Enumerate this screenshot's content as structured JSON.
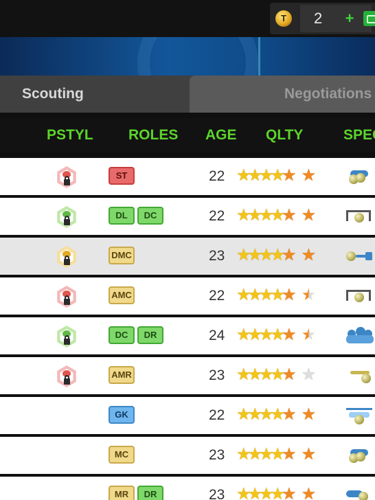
{
  "topbar": {
    "coin_symbol": "T",
    "coin_value": "2",
    "plus_label": "+",
    "coin_icon": "token-coin-icon",
    "cash_icon": "cash-icon"
  },
  "tabs": [
    {
      "label": "Scouting",
      "active": true
    },
    {
      "label": "Negotiations",
      "active": false
    }
  ],
  "columns": [
    "PSTYL",
    "ROLES",
    "AGE",
    "QLTY",
    "SPEC"
  ],
  "colors": {
    "header_green": "#5cd42b",
    "star_gold": "#f3c419",
    "star_orange": "#f08a22",
    "role_red": "#e86a6a",
    "role_green": "#7fd86a",
    "role_yellow": "#f0d98a",
    "role_blue": "#6fb6ee"
  },
  "players": [
    {
      "pstyl": "red",
      "roles": [
        {
          "label": "ST",
          "color": "red"
        }
      ],
      "age": "22",
      "quality": 4.5,
      "potential": "full",
      "spec": "dribbling-icon"
    },
    {
      "pstyl": "green",
      "roles": [
        {
          "label": "DL",
          "color": "green"
        },
        {
          "label": "DC",
          "color": "green"
        }
      ],
      "age": "22",
      "quality": 4.5,
      "potential": "full",
      "spec": "goal-icon"
    },
    {
      "pstyl": "yellow",
      "roles": [
        {
          "label": "DMC",
          "color": "yellow"
        }
      ],
      "age": "23",
      "quality": 4.5,
      "potential": "full",
      "spec": "pass-icon",
      "highlight": true
    },
    {
      "pstyl": "red",
      "roles": [
        {
          "label": "AMC",
          "color": "yellow"
        }
      ],
      "age": "22",
      "quality": 4.5,
      "potential": "half",
      "spec": "goal-icon"
    },
    {
      "pstyl": "green",
      "roles": [
        {
          "label": "DC",
          "color": "green"
        },
        {
          "label": "DR",
          "color": "green"
        }
      ],
      "age": "24",
      "quality": 4.5,
      "potential": "half",
      "spec": "team-icon"
    },
    {
      "pstyl": "red",
      "roles": [
        {
          "label": "AMR",
          "color": "yellow"
        }
      ],
      "age": "23",
      "quality": 4.5,
      "potential": "empty",
      "spec": "cross-icon"
    },
    {
      "pstyl": "",
      "roles": [
        {
          "label": "GK",
          "color": "blue"
        }
      ],
      "age": "22",
      "quality": 4.5,
      "potential": "full",
      "spec": "goalkeeper-icon"
    },
    {
      "pstyl": "",
      "roles": [
        {
          "label": "MC",
          "color": "yellow"
        }
      ],
      "age": "23",
      "quality": 4.5,
      "potential": "full",
      "spec": "dribbling-icon"
    },
    {
      "pstyl": "",
      "roles": [
        {
          "label": "MR",
          "color": "yellow"
        },
        {
          "label": "DR",
          "color": "green"
        }
      ],
      "age": "23",
      "quality": 4.5,
      "potential": "full",
      "spec": "tackle-icon"
    }
  ]
}
